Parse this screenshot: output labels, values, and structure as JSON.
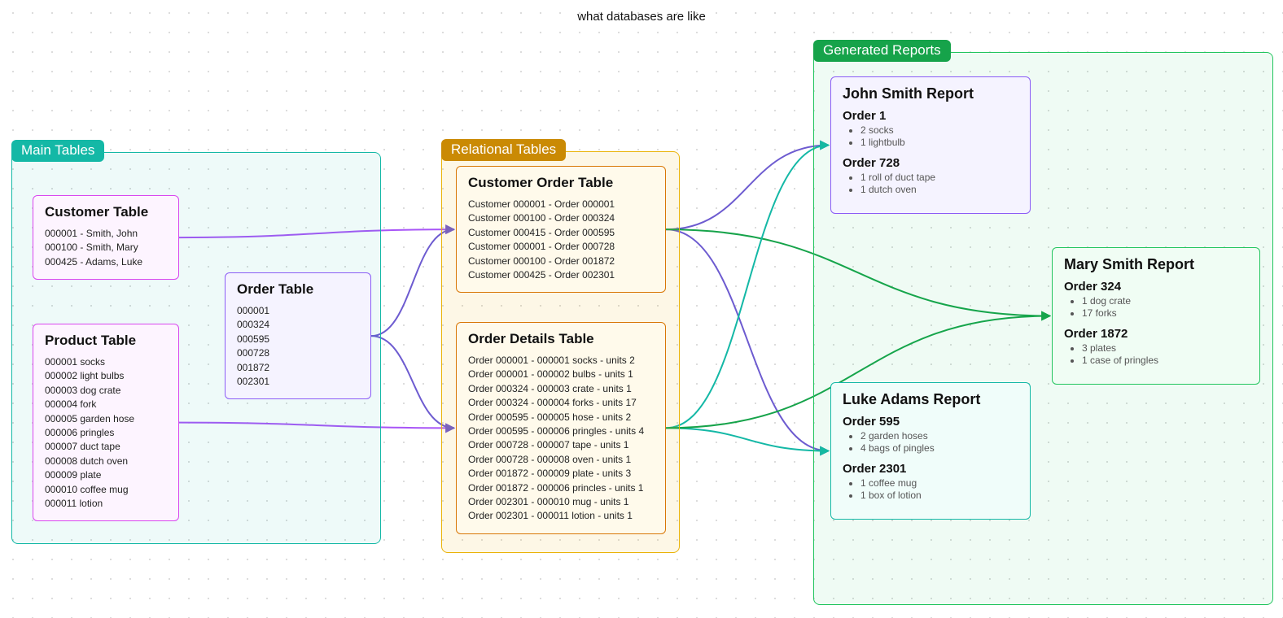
{
  "title": "what databases are like",
  "groups": {
    "main": "Main Tables",
    "relational": "Relational Tables",
    "reports": "Generated Reports"
  },
  "customer_table": {
    "title": "Customer Table",
    "rows": [
      "000001 - Smith, John",
      "000100 - Smith, Mary",
      "000425 - Adams, Luke"
    ]
  },
  "product_table": {
    "title": "Product Table",
    "rows": [
      "000001 socks",
      "000002 light bulbs",
      "000003 dog crate",
      "000004 fork",
      "000005 garden hose",
      "000006 pringles",
      "000007 duct tape",
      "000008 dutch oven",
      "000009 plate",
      "000010 coffee mug",
      "000011 lotion"
    ]
  },
  "order_table": {
    "title": "Order Table",
    "rows": [
      "000001",
      "000324",
      "000595",
      "000728",
      "001872",
      "002301"
    ]
  },
  "customer_order_table": {
    "title": "Customer Order Table",
    "rows": [
      "Customer 000001 - Order 000001",
      "Customer 000100 - Order 000324",
      "Customer 000415 - Order 000595",
      "Customer 000001 - Order 000728",
      "Customer 000100 - Order 001872",
      "Customer 000425 - Order 002301"
    ]
  },
  "order_details_table": {
    "title": "Order Details Table",
    "rows": [
      "Order 000001 - 000001 socks - units 2",
      "Order 000001 - 000002 bulbs - units 1",
      "Order 000324 - 000003 crate - units 1",
      "Order 000324 - 000004 forks - units 17",
      "Order 000595 - 000005 hose - units 2",
      "Order 000595 - 000006 pringles - units 4",
      "Order 000728 - 000007 tape - units 1",
      "Order 000728 - 000008 oven - units 1",
      "Order 001872 - 000009 plate - units 3",
      "Order 001872 - 000006 princles - units 1",
      "Order 002301 - 000010 mug - units 1",
      "Order 002301 - 000011 lotion - units 1"
    ]
  },
  "reports": {
    "john": {
      "title": "John Smith Report",
      "orders": [
        {
          "title": "Order 1",
          "items": [
            "2 socks",
            "1 lightbulb"
          ]
        },
        {
          "title": "Order 728",
          "items": [
            "1 roll of duct tape",
            "1 dutch oven"
          ]
        }
      ]
    },
    "luke": {
      "title": "Luke Adams Report",
      "orders": [
        {
          "title": "Order 595",
          "items": [
            "2 garden hoses",
            "4 bags of pingles"
          ]
        },
        {
          "title": "Order 2301",
          "items": [
            "1 coffee mug",
            "1 box of lotion"
          ]
        }
      ]
    },
    "mary": {
      "title": "Mary Smith Report",
      "orders": [
        {
          "title": "Order 324",
          "items": [
            "1 dog crate",
            "17 forks"
          ]
        },
        {
          "title": "Order 1872",
          "items": [
            "3 plates",
            "1 case of pringles"
          ]
        }
      ]
    }
  },
  "edges": [
    {
      "from": "customer",
      "to": "custorder",
      "color": "#a855f7"
    },
    {
      "from": "product",
      "to": "orderdet",
      "color": "#a855f7"
    },
    {
      "from": "order",
      "to": "custorder",
      "color": "#6d5bd0"
    },
    {
      "from": "order",
      "to": "orderdet",
      "color": "#6d5bd0"
    },
    {
      "from": "custorder",
      "to": "rep-john",
      "color": "#6d5bd0"
    },
    {
      "from": "custorder",
      "to": "rep-luke",
      "color": "#6d5bd0"
    },
    {
      "from": "custorder",
      "to": "rep-mary",
      "color": "#16a34a"
    },
    {
      "from": "orderdet",
      "to": "rep-john",
      "color": "#14b8a6"
    },
    {
      "from": "orderdet",
      "to": "rep-luke",
      "color": "#14b8a6"
    },
    {
      "from": "orderdet",
      "to": "rep-mary",
      "color": "#16a34a"
    }
  ]
}
